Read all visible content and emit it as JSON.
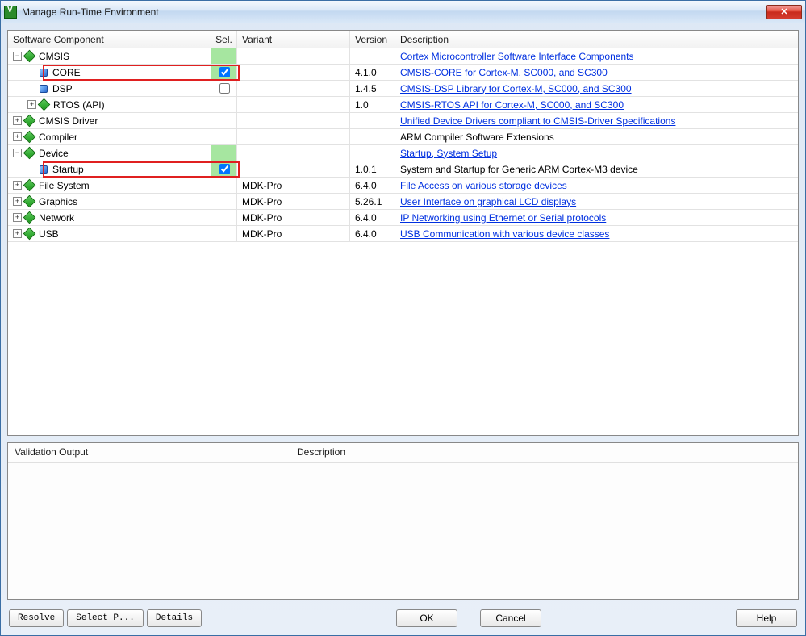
{
  "window": {
    "title": "Manage Run-Time Environment"
  },
  "columns": {
    "component": "Software Component",
    "sel": "Sel.",
    "variant": "Variant",
    "version": "Version",
    "description": "Description"
  },
  "rows": [
    {
      "depth": 0,
      "toggle": "minus",
      "icon": "diamond",
      "label": "CMSIS",
      "selBg": "green",
      "selChk": null,
      "variant": "",
      "version": "",
      "descLink": true,
      "desc": "Cortex Microcontroller Software Interface Components"
    },
    {
      "depth": 1,
      "toggle": "blank",
      "icon": "leaf",
      "label": "CORE",
      "selBg": "green",
      "selChk": true,
      "variant": "",
      "version": "4.1.0",
      "descLink": true,
      "desc": "CMSIS-CORE for Cortex-M, SC000, and SC300"
    },
    {
      "depth": 1,
      "toggle": "blank",
      "icon": "leaf",
      "label": "DSP",
      "selBg": "white",
      "selChk": false,
      "variant": "",
      "version": "1.4.5",
      "descLink": true,
      "desc": "CMSIS-DSP Library for Cortex-M, SC000, and SC300"
    },
    {
      "depth": 1,
      "toggle": "plus",
      "icon": "diamond",
      "label": "RTOS (API)",
      "selBg": null,
      "selChk": null,
      "variant": "",
      "version": "1.0",
      "descLink": true,
      "desc": "CMSIS-RTOS API for Cortex-M, SC000, and SC300"
    },
    {
      "depth": 0,
      "toggle": "plus",
      "icon": "diamond",
      "label": "CMSIS Driver",
      "selBg": null,
      "selChk": null,
      "variant": "",
      "version": "",
      "descLink": true,
      "desc": "Unified Device Drivers compliant to CMSIS-Driver Specifications"
    },
    {
      "depth": 0,
      "toggle": "plus",
      "icon": "diamond",
      "label": "Compiler",
      "selBg": null,
      "selChk": null,
      "variant": "",
      "version": "",
      "descLink": false,
      "desc": "ARM Compiler Software Extensions"
    },
    {
      "depth": 0,
      "toggle": "minus",
      "icon": "diamond",
      "label": "Device",
      "selBg": "green",
      "selChk": null,
      "variant": "",
      "version": "",
      "descLink": true,
      "desc": "Startup, System Setup"
    },
    {
      "depth": 1,
      "toggle": "blank",
      "icon": "leaf",
      "label": "Startup",
      "selBg": "green",
      "selChk": true,
      "variant": "",
      "version": "1.0.1",
      "descLink": false,
      "desc": "System and Startup for Generic ARM Cortex-M3 device"
    },
    {
      "depth": 0,
      "toggle": "plus",
      "icon": "diamond",
      "label": "File System",
      "selBg": null,
      "selChk": null,
      "variant": "MDK-Pro",
      "version": "6.4.0",
      "descLink": true,
      "desc": "File Access on various storage devices"
    },
    {
      "depth": 0,
      "toggle": "plus",
      "icon": "diamond",
      "label": "Graphics",
      "selBg": null,
      "selChk": null,
      "variant": "MDK-Pro",
      "version": "5.26.1",
      "descLink": true,
      "desc": "User Interface on graphical LCD displays"
    },
    {
      "depth": 0,
      "toggle": "plus",
      "icon": "diamond",
      "label": "Network",
      "selBg": null,
      "selChk": null,
      "variant": "MDK-Pro",
      "version": "6.4.0",
      "descLink": true,
      "desc": "IP Networking using Ethernet or Serial protocols"
    },
    {
      "depth": 0,
      "toggle": "plus",
      "icon": "diamond",
      "label": "USB",
      "selBg": null,
      "selChk": null,
      "variant": "MDK-Pro",
      "version": "6.4.0",
      "descLink": true,
      "desc": "USB Communication with various device classes"
    }
  ],
  "validation": {
    "output_label": "Validation Output",
    "description_label": "Description"
  },
  "buttons": {
    "resolve": "Resolve",
    "select_packs": "Select P...",
    "details": "Details",
    "ok": "OK",
    "cancel": "Cancel",
    "help": "Help"
  }
}
